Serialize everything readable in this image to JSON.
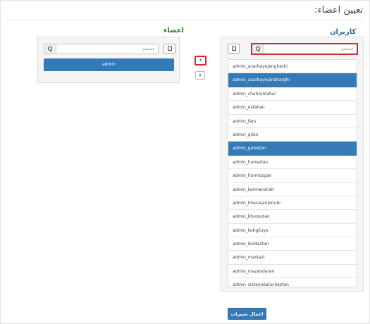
{
  "page": {
    "title": "تعیین اعضاء:"
  },
  "users_panel": {
    "heading": "کاربران",
    "search_placeholder": "جستجو",
    "items": [
      {
        "label": "admin_azarbayejangharbi",
        "selected": false
      },
      {
        "label": "admin_azarbayejansharghi",
        "selected": true
      },
      {
        "label": "admin_chaharmahal",
        "selected": false
      },
      {
        "label": "admin_esfahan",
        "selected": false
      },
      {
        "label": "admin_fars",
        "selected": false
      },
      {
        "label": "admin_gilan",
        "selected": false
      },
      {
        "label": "admin_golestan",
        "selected": true
      },
      {
        "label": "admin_hamedan",
        "selected": false
      },
      {
        "label": "admin_hormozgan",
        "selected": false
      },
      {
        "label": "admin_kermanshah",
        "selected": false
      },
      {
        "label": "admin_khorasanjonubi",
        "selected": false
      },
      {
        "label": "admin_khuzestan",
        "selected": false
      },
      {
        "label": "admin_kohgiluye",
        "selected": false
      },
      {
        "label": "admin_kordestan",
        "selected": false
      },
      {
        "label": "admin_markazi",
        "selected": false
      },
      {
        "label": "admin_mazandaran",
        "selected": false
      },
      {
        "label": "admin_sistanobaluchestan",
        "selected": false
      }
    ]
  },
  "members_panel": {
    "heading": "اعضاء",
    "search_placeholder": "جستجو",
    "items": [
      {
        "label": "admin",
        "selected": true
      }
    ]
  },
  "transfer": {
    "move_left_glyph": "‹",
    "move_right_glyph": "›"
  },
  "actions": {
    "apply_label": "اعمال تغییرات"
  }
}
